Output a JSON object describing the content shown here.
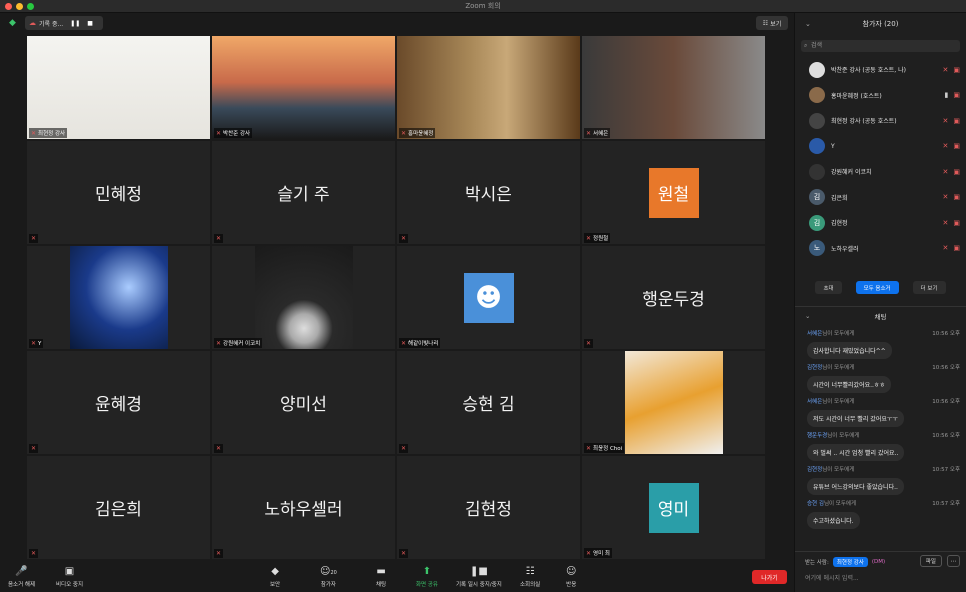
{
  "window": {
    "title": "Zoom 회의",
    "dot_colors": [
      "#ff5f57",
      "#febc2e",
      "#28c840"
    ]
  },
  "topbar": {
    "recording_label": "기록 중...",
    "view_label": "보기"
  },
  "tiles": [
    {
      "label": "최현정 강사",
      "video": true,
      "pic": "book"
    },
    {
      "label": "박찬준 강사",
      "video": true,
      "pic": "bridge"
    },
    {
      "label": "홍마윤혜정",
      "video": true,
      "pic": "shelf"
    },
    {
      "label": "서혜은",
      "video": true,
      "pic": "room"
    },
    {
      "name": "민혜정",
      "label": ""
    },
    {
      "name": "슬기 주",
      "label": ""
    },
    {
      "name": "박시은",
      "label": ""
    },
    {
      "name": "원철",
      "label": "정원철",
      "avatar_color": "#e8782a"
    },
    {
      "label": "Y",
      "pic": "space"
    },
    {
      "label": "강원혜커 이코치",
      "pic": "hood"
    },
    {
      "label": "해같이빛나리",
      "pic": "user"
    },
    {
      "name": "행운두경",
      "label": ""
    },
    {
      "name": "윤혜경",
      "label": ""
    },
    {
      "name": "양미선",
      "label": ""
    },
    {
      "name": "승현 김",
      "label": ""
    },
    {
      "label": "최윤정 Choi",
      "pic": "orange"
    },
    {
      "name": "김은희",
      "label": ""
    },
    {
      "name": "노하우셀러",
      "label": ""
    },
    {
      "name": "김현정",
      "label": ""
    },
    {
      "name": "영미",
      "label": "영미 최",
      "avatar_color": "#2a9ea8"
    }
  ],
  "participants": {
    "header": "참가자 (20)",
    "search_placeholder": "검색",
    "items": [
      {
        "name": "박찬준 강사 (공동 호스트, 나)",
        "avatar_color": "#ddd",
        "initial": ""
      },
      {
        "name": "홍마윤혜정 (호스트)",
        "avatar_color": "#8a6a4a",
        "initial": ""
      },
      {
        "name": "최현정 강사 (공동 호스트)",
        "avatar_color": "#444",
        "initial": ""
      },
      {
        "name": "Y",
        "avatar_color": "#2a5aa8",
        "initial": ""
      },
      {
        "name": "강원혜커 이코치",
        "avatar_color": "#333",
        "initial": ""
      },
      {
        "name": "김은희",
        "avatar_color": "#4a5a6a",
        "initial": "김"
      },
      {
        "name": "김현정",
        "avatar_color": "#3a9a7a",
        "initial": "김"
      },
      {
        "name": "노하우셀러",
        "avatar_color": "#3a5a7a",
        "initial": "노"
      }
    ],
    "invite_label": "초대",
    "mute_all_label": "모두 음소거",
    "more_label": "더 보기"
  },
  "chat": {
    "header": "채팅",
    "messages": [
      {
        "from": "서혜은",
        "to": "님이 모두에게",
        "time": "10:56 오후",
        "text": "감사합니다 재밌었습니다^^"
      },
      {
        "from": "김현정",
        "to": "님이 모두에게",
        "time": "10:56 오후",
        "text": "시간이 너무빨리갔어요..ㅎㅎ"
      },
      {
        "from": "서혜은",
        "to": "님이 모두에게",
        "time": "10:56 오후",
        "text": "저도 시간이 너무 빨리 갔어요ㅜㅜ"
      },
      {
        "from": "행운두경",
        "to": "님이 모두에게",
        "time": "10:56 오후",
        "text": "와 벌써 .. 시간 엄청 빨리 갔어요.."
      },
      {
        "from": "김현정",
        "to": "님이 모두에게",
        "time": "10:57 오후",
        "text": "유튜브 어느강의보다 좋았습니다.."
      },
      {
        "from": "승현 김",
        "to": "님이 모두에게",
        "time": "10:57 오후",
        "text": "수고하셨습니다."
      }
    ],
    "to_label": "받는 사람:",
    "recipient": "최현정 강사",
    "dm_label": "(DM)",
    "file_label": "파일",
    "input_placeholder": "여기에 메시지 입력..."
  },
  "toolbar": {
    "mute": "음소거 해제",
    "video": "비디오 중지",
    "security": "보안",
    "participants": "참가자",
    "participants_count": "20",
    "chat": "채팅",
    "share": "화면 공유",
    "record": "기록 일시 중지/중지",
    "breakout": "소회의실",
    "reactions": "반응",
    "leave": "나가기"
  }
}
